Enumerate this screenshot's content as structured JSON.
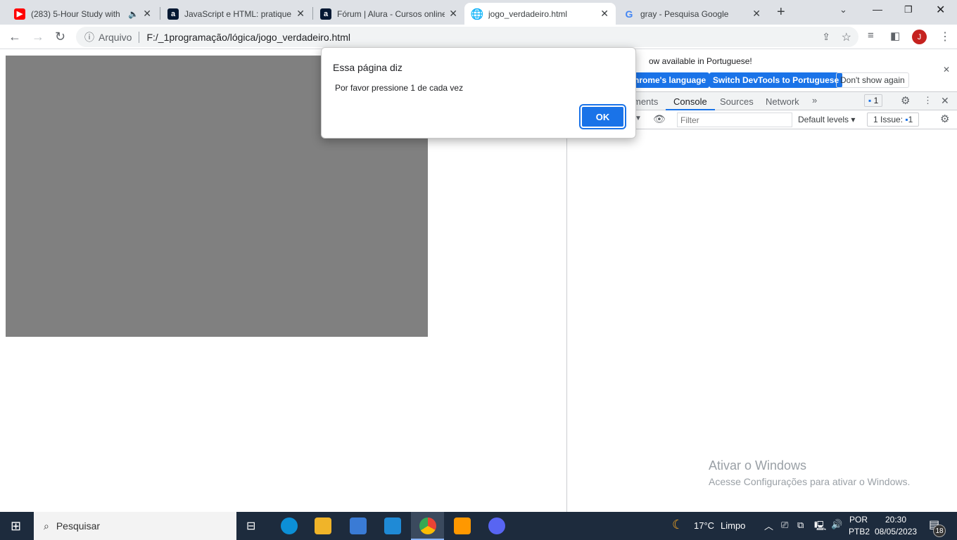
{
  "tabs": [
    {
      "title": "(283) 5-Hour Study with",
      "favicon": "youtube-icon",
      "audio": true
    },
    {
      "title": "JavaScript e HTML: pratique l",
      "favicon": "alura-icon"
    },
    {
      "title": "Fórum | Alura - Cursos online",
      "favicon": "alura-icon"
    },
    {
      "title": "jogo_verdadeiro.html",
      "favicon": "globe-icon",
      "active": true
    },
    {
      "title": "gray - Pesquisa Google",
      "favicon": "google-icon"
    }
  ],
  "address": {
    "scheme_label": "Arquivo",
    "url": "F:/_1programação/lógica/jogo_verdadeiro.html"
  },
  "profile_initial": "J",
  "page": {
    "square_color": "#808080"
  },
  "dialog": {
    "title": "Essa página diz",
    "message": "Por favor pressione 1 de cada vez",
    "ok": "OK"
  },
  "devtools": {
    "banner": "ow available in Portuguese!",
    "btn_lang": "hrome's language",
    "btn_switch": "Switch DevTools to Portuguese",
    "btn_dont": "Don't show again",
    "tabs": [
      "ments",
      "Console",
      "Sources",
      "Network"
    ],
    "active_tab": "Console",
    "msg_count": "1",
    "filter_placeholder": "Filter",
    "levels": "Default levels",
    "issues": "1 Issue:",
    "issues_count": "1"
  },
  "watermark": {
    "title": "Ativar o Windows",
    "sub": "Acesse Configurações para ativar o Windows."
  },
  "taskbar": {
    "search": "Pesquisar",
    "temp": "17°C",
    "weather": "Limpo",
    "lang1": "POR",
    "lang2": "PTB2",
    "time": "20:30",
    "date": "08/05/2023",
    "notifications": "18"
  }
}
